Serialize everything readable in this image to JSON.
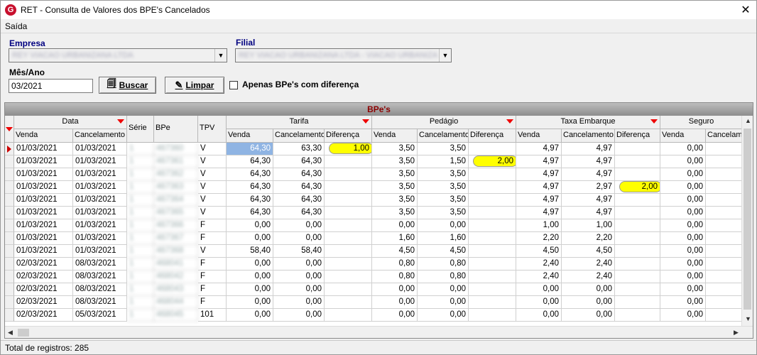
{
  "window": {
    "title": "RET - Consulta de Valores dos BPE's Cancelados",
    "close": "✕",
    "app_icon": "G"
  },
  "menu": {
    "exit": "Saída"
  },
  "form": {
    "empresa_label": "Empresa",
    "empresa_value": "REY VIACAO URBANIZANA LTDA",
    "filial_label": "Filial",
    "filial_value": "REY VIACAO URBANIZANA LTDA - VIACAO URBANIZANA",
    "mes_ano_label": "Mês/Ano",
    "mes_ano_value": "03/2021",
    "search_label": "Buscar",
    "clear_label": "Limpar",
    "only_diff_label": "Apenas BPe's com diferença"
  },
  "grid": {
    "band_title": "BPe's",
    "groups": {
      "data": "Data",
      "tarifa": "Tarifa",
      "pedagio": "Pedágio",
      "taxa": "Taxa Embarque",
      "seguro": "Seguro"
    },
    "cols": {
      "venda": "Venda",
      "cancelamento": "Cancelamento",
      "serie": "Série",
      "bpe": "BPe",
      "tpv": "TPV",
      "t_venda": "Venda",
      "t_canc": "Cancelamento",
      "t_dif": "Diferença",
      "p_venda": "Venda",
      "p_canc": "Cancelamento",
      "p_dif": "Diferença",
      "e_venda": "Venda",
      "e_canc": "Cancelamento",
      "e_dif": "Diferença",
      "s_venda": "Venda",
      "s_canc": "Cancelam"
    },
    "rows": [
      {
        "venda": "01/03/2021",
        "canc": "01/03/2021",
        "serie": "1",
        "bpe": "467360",
        "tpv": "V",
        "tv": "64,30",
        "tc": "63,30",
        "td": "1,00",
        "pv": "3,50",
        "pc": "3,50",
        "pd": "",
        "ev": "4,97",
        "ec": "4,97",
        "ed": "",
        "sv": "0,00",
        "sc": ""
      },
      {
        "venda": "01/03/2021",
        "canc": "01/03/2021",
        "serie": "1",
        "bpe": "467361",
        "tpv": "V",
        "tv": "64,30",
        "tc": "64,30",
        "td": "",
        "pv": "3,50",
        "pc": "1,50",
        "pd": "2,00",
        "ev": "4,97",
        "ec": "4,97",
        "ed": "",
        "sv": "0,00",
        "sc": ""
      },
      {
        "venda": "01/03/2021",
        "canc": "01/03/2021",
        "serie": "1",
        "bpe": "467362",
        "tpv": "V",
        "tv": "64,30",
        "tc": "64,30",
        "td": "",
        "pv": "3,50",
        "pc": "3,50",
        "pd": "",
        "ev": "4,97",
        "ec": "4,97",
        "ed": "",
        "sv": "0,00",
        "sc": ""
      },
      {
        "venda": "01/03/2021",
        "canc": "01/03/2021",
        "serie": "1",
        "bpe": "467363",
        "tpv": "V",
        "tv": "64,30",
        "tc": "64,30",
        "td": "",
        "pv": "3,50",
        "pc": "3,50",
        "pd": "",
        "ev": "4,97",
        "ec": "2,97",
        "ed": "2,00",
        "sv": "0,00",
        "sc": ""
      },
      {
        "venda": "01/03/2021",
        "canc": "01/03/2021",
        "serie": "1",
        "bpe": "467364",
        "tpv": "V",
        "tv": "64,30",
        "tc": "64,30",
        "td": "",
        "pv": "3,50",
        "pc": "3,50",
        "pd": "",
        "ev": "4,97",
        "ec": "4,97",
        "ed": "",
        "sv": "0,00",
        "sc": ""
      },
      {
        "venda": "01/03/2021",
        "canc": "01/03/2021",
        "serie": "1",
        "bpe": "467365",
        "tpv": "V",
        "tv": "64,30",
        "tc": "64,30",
        "td": "",
        "pv": "3,50",
        "pc": "3,50",
        "pd": "",
        "ev": "4,97",
        "ec": "4,97",
        "ed": "",
        "sv": "0,00",
        "sc": ""
      },
      {
        "venda": "01/03/2021",
        "canc": "01/03/2021",
        "serie": "1",
        "bpe": "467366",
        "tpv": "F",
        "tv": "0,00",
        "tc": "0,00",
        "td": "",
        "pv": "0,00",
        "pc": "0,00",
        "pd": "",
        "ev": "1,00",
        "ec": "1,00",
        "ed": "",
        "sv": "0,00",
        "sc": ""
      },
      {
        "venda": "01/03/2021",
        "canc": "01/03/2021",
        "serie": "1",
        "bpe": "467367",
        "tpv": "F",
        "tv": "0,00",
        "tc": "0,00",
        "td": "",
        "pv": "1,60",
        "pc": "1,60",
        "pd": "",
        "ev": "2,20",
        "ec": "2,20",
        "ed": "",
        "sv": "0,00",
        "sc": ""
      },
      {
        "venda": "01/03/2021",
        "canc": "01/03/2021",
        "serie": "1",
        "bpe": "467368",
        "tpv": "V",
        "tv": "58,40",
        "tc": "58,40",
        "td": "",
        "pv": "4,50",
        "pc": "4,50",
        "pd": "",
        "ev": "4,50",
        "ec": "4,50",
        "ed": "",
        "sv": "0,00",
        "sc": ""
      },
      {
        "venda": "02/03/2021",
        "canc": "08/03/2021",
        "serie": "1",
        "bpe": "468041",
        "tpv": "F",
        "tv": "0,00",
        "tc": "0,00",
        "td": "",
        "pv": "0,80",
        "pc": "0,80",
        "pd": "",
        "ev": "2,40",
        "ec": "2,40",
        "ed": "",
        "sv": "0,00",
        "sc": ""
      },
      {
        "venda": "02/03/2021",
        "canc": "08/03/2021",
        "serie": "1",
        "bpe": "468042",
        "tpv": "F",
        "tv": "0,00",
        "tc": "0,00",
        "td": "",
        "pv": "0,80",
        "pc": "0,80",
        "pd": "",
        "ev": "2,40",
        "ec": "2,40",
        "ed": "",
        "sv": "0,00",
        "sc": ""
      },
      {
        "venda": "02/03/2021",
        "canc": "08/03/2021",
        "serie": "1",
        "bpe": "468043",
        "tpv": "F",
        "tv": "0,00",
        "tc": "0,00",
        "td": "",
        "pv": "0,00",
        "pc": "0,00",
        "pd": "",
        "ev": "0,00",
        "ec": "0,00",
        "ed": "",
        "sv": "0,00",
        "sc": ""
      },
      {
        "venda": "02/03/2021",
        "canc": "08/03/2021",
        "serie": "1",
        "bpe": "468044",
        "tpv": "F",
        "tv": "0,00",
        "tc": "0,00",
        "td": "",
        "pv": "0,00",
        "pc": "0,00",
        "pd": "",
        "ev": "0,00",
        "ec": "0,00",
        "ed": "",
        "sv": "0,00",
        "sc": ""
      },
      {
        "venda": "02/03/2021",
        "canc": "05/03/2021",
        "serie": "1",
        "bpe": "468045",
        "tpv": "101",
        "tv": "0,00",
        "tc": "0,00",
        "td": "",
        "pv": "0,00",
        "pc": "0,00",
        "pd": "",
        "ev": "0,00",
        "ec": "0,00",
        "ed": "",
        "sv": "0,00",
        "sc": ""
      }
    ]
  },
  "status": {
    "text": "Total de registros: 285"
  },
  "colors": {
    "band_text": "#8b0000",
    "highlight": "#ffff00",
    "selection": "#8fb4e3",
    "sort_arrow": "#e00000"
  }
}
